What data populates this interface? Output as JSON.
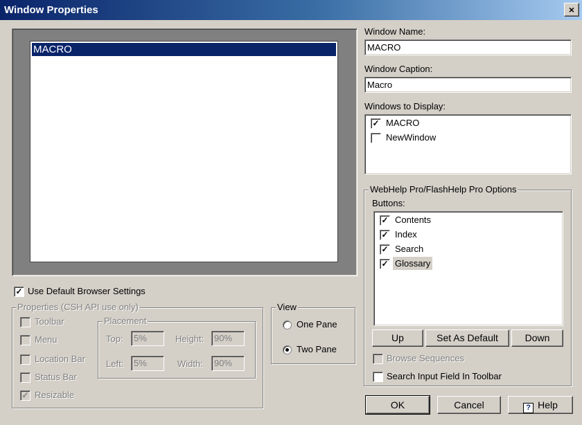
{
  "window": {
    "title": "Window Properties",
    "close_glyph": "×"
  },
  "preview": {
    "item": "MACRO"
  },
  "window_name": {
    "label": "Window Name:",
    "value": "MACRO"
  },
  "window_caption": {
    "label": "Window Caption:",
    "value": "Macro"
  },
  "windows_to_display": {
    "label": "Windows to Display:",
    "items": [
      {
        "label": "MACRO",
        "checked": true
      },
      {
        "label": "NewWindow",
        "checked": false
      }
    ]
  },
  "use_default_browser": {
    "label": "Use Default Browser Settings",
    "checked": true
  },
  "properties": {
    "legend": "Properties (CSH API use only)",
    "toolbar": "Toolbar",
    "menu": "Menu",
    "location_bar": "Location Bar",
    "status_bar": "Status Bar",
    "resizable": "Resizable"
  },
  "placement": {
    "legend": "Placement",
    "top_label": "Top:",
    "top_value": "5%",
    "height_label": "Height:",
    "height_value": "90%",
    "left_label": "Left:",
    "left_value": "5%",
    "width_label": "Width:",
    "width_value": "90%"
  },
  "view": {
    "legend": "View",
    "one_pane": "One Pane",
    "two_pane": "Two Pane",
    "selected": "Two Pane"
  },
  "webhelp": {
    "legend": "WebHelp Pro/FlashHelp Pro Options",
    "buttons_label": "Buttons:",
    "items": [
      {
        "label": "Contents",
        "checked": true
      },
      {
        "label": "Index",
        "checked": true
      },
      {
        "label": "Search",
        "checked": true
      },
      {
        "label": "Glossary",
        "checked": true
      }
    ],
    "up": "Up",
    "set_default": "Set As Default",
    "down": "Down",
    "browse_sequences": "Browse Sequences",
    "search_input": "Search Input Field In Toolbar"
  },
  "footer": {
    "ok": "OK",
    "cancel": "Cancel",
    "help": "Help",
    "help_icon_glyph": "?"
  },
  "check_glyph": "✓"
}
